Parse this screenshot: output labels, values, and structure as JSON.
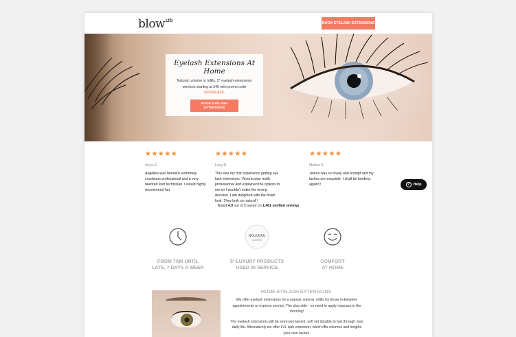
{
  "header": {
    "logo": "blow",
    "logo_suffix": "LTD",
    "cta_label": "BOOK EYELASH EXTENSIONS"
  },
  "hero": {
    "title": "Eyelash Extensions At Home",
    "text_before_promo": "Natural, volume or infills. 5* eyelash extensions services starting at £45 with promo code ",
    "promo_code": "GOOGLE10",
    "text_after_promo": ".",
    "cta_label": "BOOK EYELASH EXTENSIONS"
  },
  "reviews": [
    {
      "stars": "★★★★★",
      "name": "Anya G.",
      "text": "Angelika was fantastic extremely courteous professional and a very talented lash technician. I would highly recommend her."
    },
    {
      "stars": "★★★★★",
      "name": "Lucy B.",
      "text": "This was my first experience getting eye lash extensions. Victoria was really professional and explained the options to me so I wouldn't make the wrong decision. I am delighted with the finish look. They look so natural!!"
    },
    {
      "stars": "★★★★★",
      "name": "Marina K.",
      "text": "Jelena was so lovely and prompt and my lashes are exquisite. I shall be booking again!!!"
    }
  ],
  "rating_summary": {
    "prefix": "Rated ",
    "score": "4.9",
    "middle": " out of 5 based on ",
    "count": "1,461 verified reviews"
  },
  "features": [
    {
      "icon": "clock-icon",
      "line1": "FROM 7AM UNTIL",
      "line2": "LATE, 7 DAYS A WEEK"
    },
    {
      "icon": "nouveau-lashes-logo",
      "logo_line1": "NOUVEAU",
      "logo_line2": "LASHES",
      "line1": "5* LUXURY PRODUCTS",
      "line2": "USED IN SERVICE"
    },
    {
      "icon": "smiley-icon",
      "line1": "COMFORT",
      "line2": "AT HOME"
    }
  ],
  "home_section": {
    "title": "HOME EYELASH EXTENSIONS",
    "paragraph1": "We offer eyelash extensions for a natural, volume, infills for those in-between appointments or express service.  The plus side - no need to apply mascara in the morning!",
    "paragraph2": "The eyelash extensions will be semi-permanent, soft yet durable to last through your daily life.  Alternatively we offer LVL lash extension, which lifts volumes and lengths your own lashes."
  },
  "help": {
    "label": "Help",
    "icon_glyph": "?"
  },
  "colors": {
    "accent": "#f47a63",
    "star": "#f09238",
    "muted": "#aaaaaa"
  }
}
